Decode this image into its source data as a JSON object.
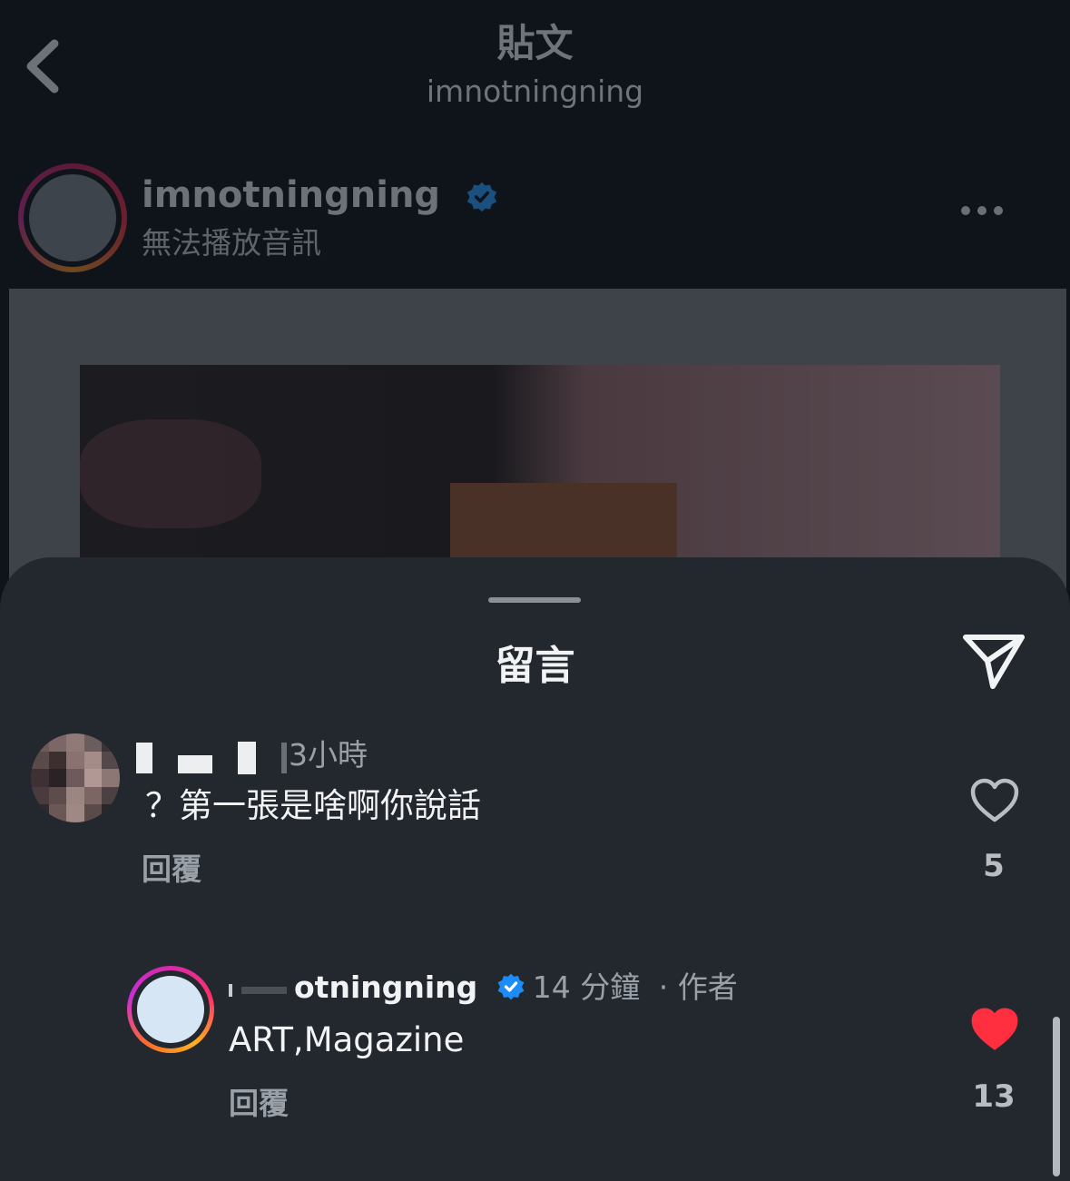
{
  "topbar": {
    "title": "貼文",
    "subtitle": "imnotningning"
  },
  "post": {
    "username": "imnotningning",
    "audio_status": "無法播放音訊",
    "verified": true
  },
  "sheet": {
    "title": "留言"
  },
  "comments": [
    {
      "username": "",
      "time": "3小時",
      "text": "？第一張是啥啊你說話",
      "reply_label": "回覆",
      "like_count": "5",
      "liked": false
    },
    {
      "username": "otningning",
      "time": "14 分鐘",
      "author_label": "· 作者",
      "text": "ART,Magazine",
      "reply_label": "回覆",
      "like_count": "13",
      "liked": true,
      "verified": true
    }
  ],
  "colors": {
    "verified_blue": "#1d8cf8",
    "like_red": "#ff2f3f",
    "sheet_bg": "#23272e"
  }
}
